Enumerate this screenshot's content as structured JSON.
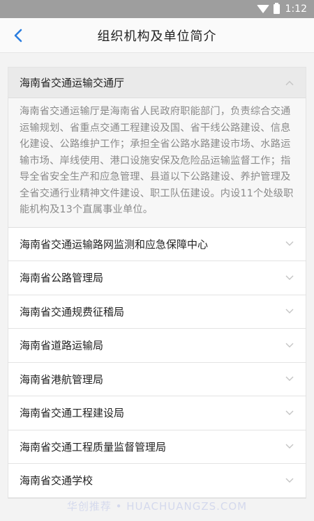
{
  "status_bar": {
    "time": "1:12"
  },
  "app_bar": {
    "title": "组织机构及单位简介"
  },
  "expanded": {
    "title": "海南省交通运输交通厅",
    "description": "海南省交通运输厅是海南省人民政府职能部门，负责综合交通运输规划、省重点交通工程建设及国、省干线公路建设、信息化建设、公路维护工作；承担全省公路水路建设市场、水路运输市场、岸线使用、港口设施安保及危险品运输监督工作；指导全省安全生产和应急管理、县道以下公路建设、养护管理及全省交通行业精神文件建设、职工队伍建设。内设11个处级职能机构及13个直属事业单位。"
  },
  "items": [
    {
      "label": "海南省交通运输路网监测和应急保障中心"
    },
    {
      "label": "海南省公路管理局"
    },
    {
      "label": "海南省交通规费征稽局"
    },
    {
      "label": "海南省道路运输局"
    },
    {
      "label": "海南省港航管理局"
    },
    {
      "label": "海南省交通工程建设局"
    },
    {
      "label": "海南省交通工程质量监督管理局"
    },
    {
      "label": "海南省交通学校"
    }
  ],
  "watermark": "华创推荐 • HUACHUANGZS.COM",
  "colors": {
    "accent": "#2b7ee0",
    "status_bar": "#9e9e9e"
  },
  "icons": [
    "wifi-icon",
    "battery-icon",
    "back-arrow-icon",
    "chevron-up-icon",
    "chevron-down-icon"
  ]
}
